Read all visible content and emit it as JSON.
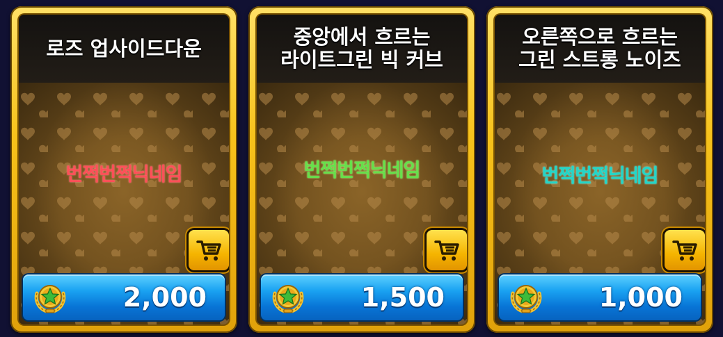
{
  "items": [
    {
      "title": "로즈 업사이드다운",
      "nickname": "번쩍번쩍닉네임",
      "nickname_color": "#ff4f58",
      "price": "2,000"
    },
    {
      "title": "중앙에서 흐르는\n라이트그린 빅 커브",
      "nickname": "번쩍번쩍닉네임",
      "nickname_color": "#66e04a",
      "price": "1,500"
    },
    {
      "title": "오른쪽으로 흐르는\n그린 스트롱 노이즈",
      "nickname": "번쩍번쩍닉네임",
      "nickname_color": "#22d6c8",
      "price": "1,000"
    }
  ],
  "icons": {
    "cart": "shopping-cart-icon",
    "currency": "star-medal-icon"
  }
}
